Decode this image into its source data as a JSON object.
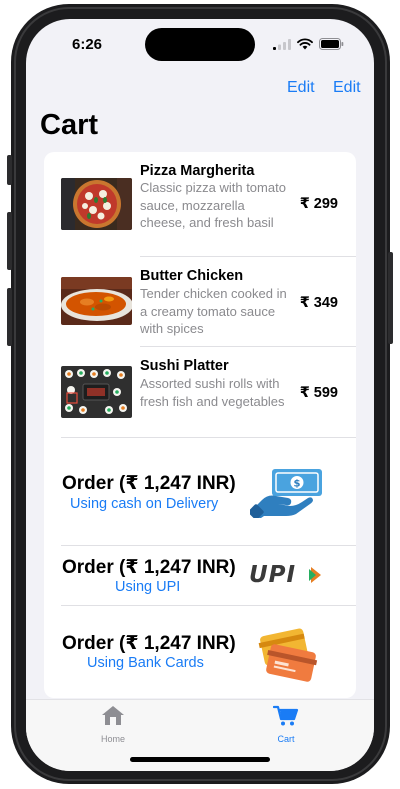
{
  "status_bar": {
    "time": "6:26"
  },
  "nav": {
    "edit_left": "Edit",
    "edit_right": "Edit",
    "title": "Cart"
  },
  "cart_items": [
    {
      "name": "Pizza Margherita",
      "description": "Classic pizza with tomato sauce, mozzarella cheese, and fresh basil",
      "price": "₹ 299"
    },
    {
      "name": "Butter Chicken",
      "description": "Tender chicken cooked in a creamy tomato sauce with spices",
      "price": "₹ 349"
    },
    {
      "name": "Sushi Platter",
      "description": "Assorted sushi rolls with fresh fish and vegetables",
      "price": "₹ 599"
    }
  ],
  "order_options": [
    {
      "title": "Order (₹ 1,247 INR)",
      "subtitle": "Using cash on Delivery",
      "icon": "cash-hand-icon"
    },
    {
      "title": "Order (₹ 1,247 INR)",
      "subtitle": "Using UPI",
      "icon": "upi-logo"
    },
    {
      "title": "Order (₹ 1,247 INR)",
      "subtitle": "Using Bank Cards",
      "icon": "credit-cards-icon"
    }
  ],
  "upi_logo_text": "UPI",
  "tabs": [
    {
      "label": "Home",
      "icon": "house-icon",
      "active": false
    },
    {
      "label": "Cart",
      "icon": "cart-icon",
      "active": true
    }
  ],
  "colors": {
    "accent": "#1a7cf5",
    "inactive_tab": "#8e8e93",
    "background": "#f2f2f7"
  }
}
